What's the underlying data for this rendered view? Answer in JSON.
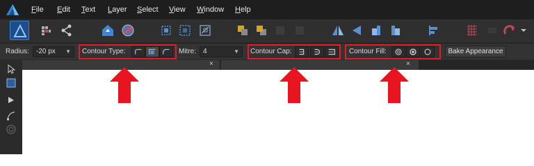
{
  "menu": {
    "items": [
      {
        "pre": "",
        "u": "F",
        "post": "ile"
      },
      {
        "pre": "",
        "u": "E",
        "post": "dit"
      },
      {
        "pre": "",
        "u": "T",
        "post": "ext"
      },
      {
        "pre": "",
        "u": "L",
        "post": "ayer"
      },
      {
        "pre": "",
        "u": "S",
        "post": "elect"
      },
      {
        "pre": "",
        "u": "V",
        "post": "iew"
      },
      {
        "pre": "",
        "u": "W",
        "post": "indow"
      },
      {
        "pre": "",
        "u": "H",
        "post": "elp"
      }
    ]
  },
  "context": {
    "radius_label": "Radius:",
    "radius_value": "-20 px",
    "contour_type_label": "Contour Type:",
    "mitre_label": "Mitre:",
    "mitre_value": "4",
    "contour_cap_label": "Contour Cap:",
    "contour_fill_label": "Contour Fill:",
    "bake_label": "Bake Appearance"
  },
  "tabs": {
    "close_glyph": "×"
  },
  "colors": {
    "highlight": "#e01c2a",
    "arrow": "#e8141f",
    "accent": "#3e7fd0"
  }
}
